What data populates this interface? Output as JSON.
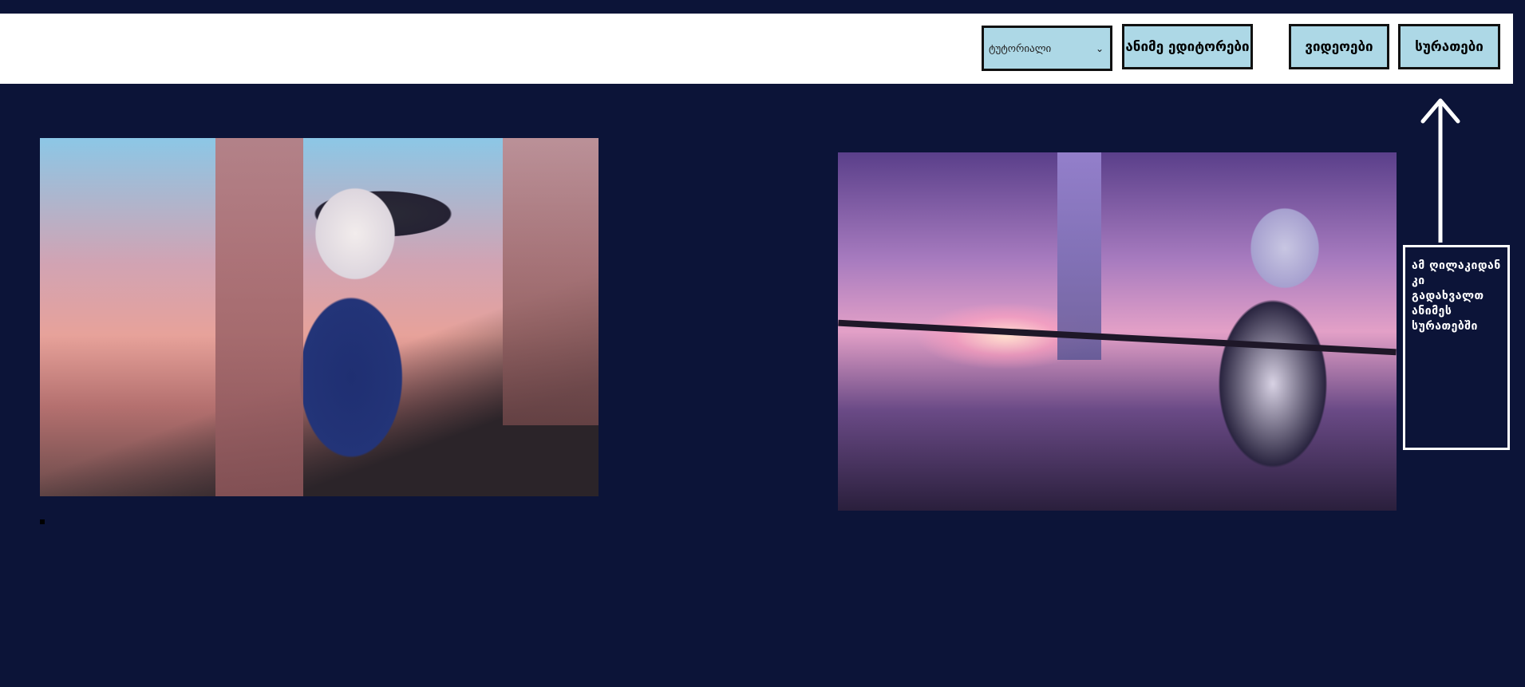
{
  "nav": {
    "select_value": "ტუტორიალი",
    "editors_label": "ანიმე ედიტორები",
    "videos_label": "ვიდეოები",
    "images_label": "სურათები"
  },
  "info": {
    "text": "ამ ღილაკიდან კი გადახვალთ ანიმეს სურათებში"
  },
  "colors": {
    "background": "#0c1438",
    "nav_background": "#ffffff",
    "button_background": "#add8e6"
  },
  "icons": {
    "arrow": "arrow-up-icon",
    "select_caret": "chevron-down-icon"
  }
}
